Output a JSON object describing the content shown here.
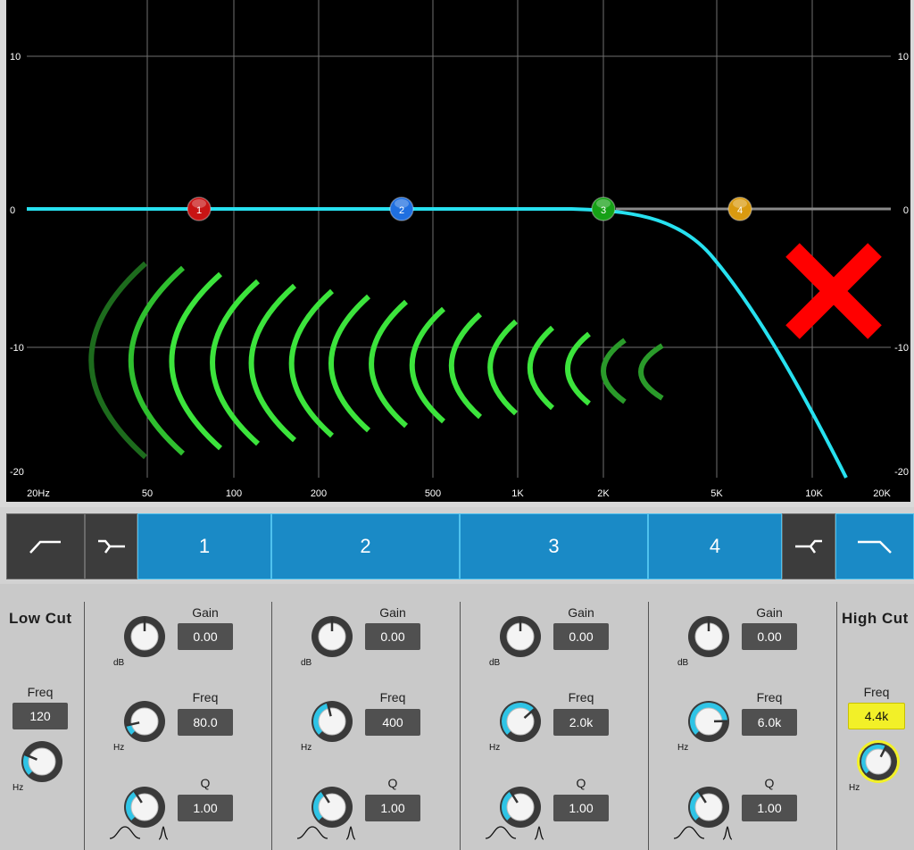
{
  "graph": {
    "db_labels_left": [
      "10",
      "0",
      "-10",
      "-20"
    ],
    "db_labels_right": [
      "10",
      "0",
      "-10",
      "-20"
    ],
    "freq_labels": [
      "20Hz",
      "50",
      "100",
      "200",
      "500",
      "1K",
      "2K",
      "5K",
      "10K",
      "20K"
    ],
    "nodes": [
      {
        "label": "1",
        "color": "#c81414"
      },
      {
        "label": "2",
        "color": "#1f6fe0"
      },
      {
        "label": "3",
        "color": "#16a016"
      },
      {
        "label": "4",
        "color": "#d99a10"
      }
    ],
    "curve_color": "#27e1f0",
    "overlay_icon": "red-x-icon",
    "sound_wave_icon": "sound-wave-icon"
  },
  "bands_bar": {
    "low_cut_icon": "low-cut-shape-icon",
    "low_shelf_icon": "low-shelf-shape-icon",
    "bands": [
      "1",
      "2",
      "3",
      "4"
    ],
    "high_shelf_icon": "high-shelf-shape-icon",
    "high_cut_icon": "high-cut-shape-icon"
  },
  "low_cut": {
    "title": "Low Cut",
    "freq_label": "Freq",
    "freq_value": "120",
    "unit": "Hz",
    "knob_level": 0.25
  },
  "bands": [
    {
      "gain_label": "Gain",
      "gain_value": "0.00",
      "gain_unit": "dB",
      "freq_label": "Freq",
      "freq_value": "80.0",
      "freq_unit": "Hz",
      "q_label": "Q",
      "q_value": "1.00",
      "freq_level": 0.12
    },
    {
      "gain_label": "Gain",
      "gain_value": "0.00",
      "gain_unit": "dB",
      "freq_label": "Freq",
      "freq_value": "400",
      "freq_unit": "Hz",
      "q_label": "Q",
      "q_value": "1.00",
      "freq_level": 0.45
    },
    {
      "gain_label": "Gain",
      "gain_value": "0.00",
      "gain_unit": "dB",
      "freq_label": "Freq",
      "freq_value": "2.0k",
      "freq_unit": "Hz",
      "q_label": "Q",
      "q_value": "1.00",
      "freq_level": 0.68
    },
    {
      "gain_label": "Gain",
      "gain_value": "0.00",
      "gain_unit": "dB",
      "freq_label": "Freq",
      "freq_value": "6.0k",
      "freq_unit": "Hz",
      "q_label": "Q",
      "q_value": "1.00",
      "freq_level": 0.83
    }
  ],
  "high_cut": {
    "title": "High Cut",
    "freq_label": "Freq",
    "freq_value": "4.4k",
    "unit": "Hz",
    "knob_level": 0.6
  },
  "colors": {
    "accent": "#1a8ac6",
    "knob_arc": "#2fc4e6",
    "highlight": "#f2f028"
  }
}
